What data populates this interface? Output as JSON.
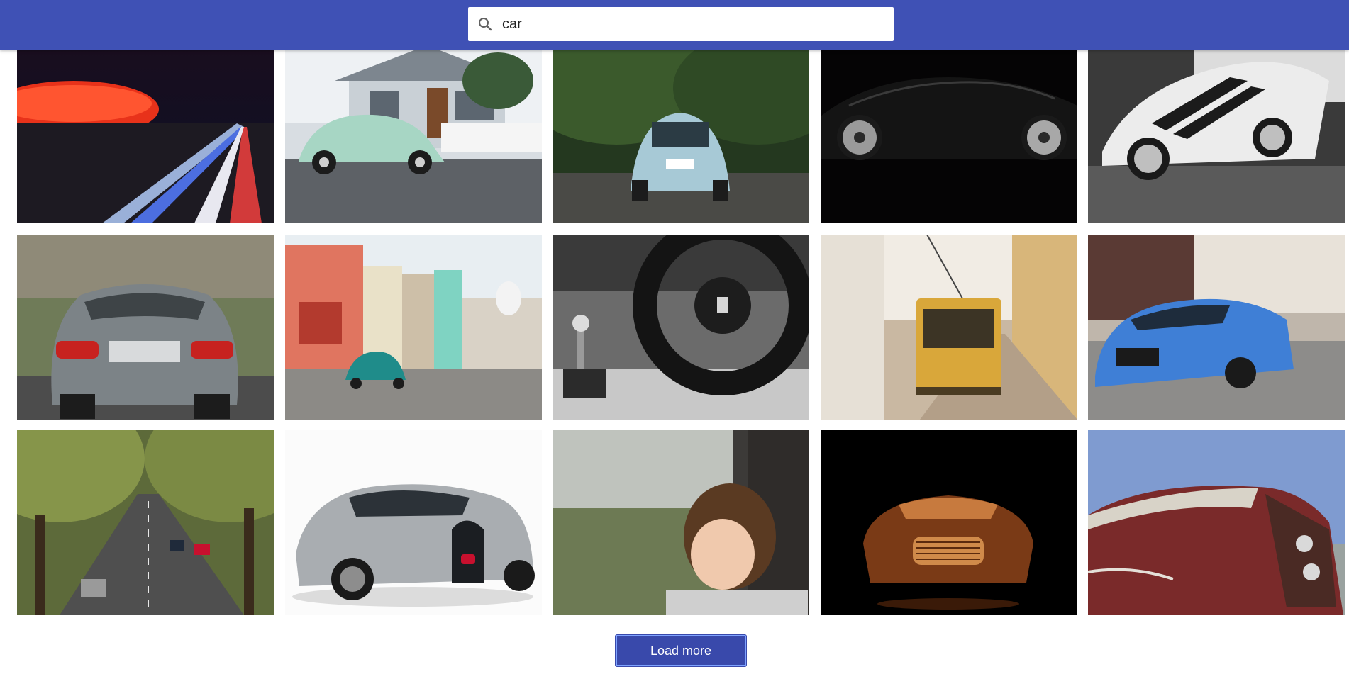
{
  "search": {
    "value": "car",
    "placeholder": ""
  },
  "photos": [
    {
      "alt": "stadium-night-highway"
    },
    {
      "alt": "mint-beetle-house"
    },
    {
      "alt": "blue-beetle-forest"
    },
    {
      "alt": "black-sports-car"
    },
    {
      "alt": "white-ford-gt"
    },
    {
      "alt": "grey-bmw-rear"
    },
    {
      "alt": "havana-street-teal-car"
    },
    {
      "alt": "steering-wheel-interior"
    },
    {
      "alt": "lisbon-yellow-tram"
    },
    {
      "alt": "blue-bmw-street"
    },
    {
      "alt": "tree-lined-avenue"
    },
    {
      "alt": "silver-bugatti"
    },
    {
      "alt": "boy-rainy-window"
    },
    {
      "alt": "orange-aston-martin"
    },
    {
      "alt": "rusty-classic-car"
    }
  ],
  "load_more": {
    "label": "Load more"
  }
}
